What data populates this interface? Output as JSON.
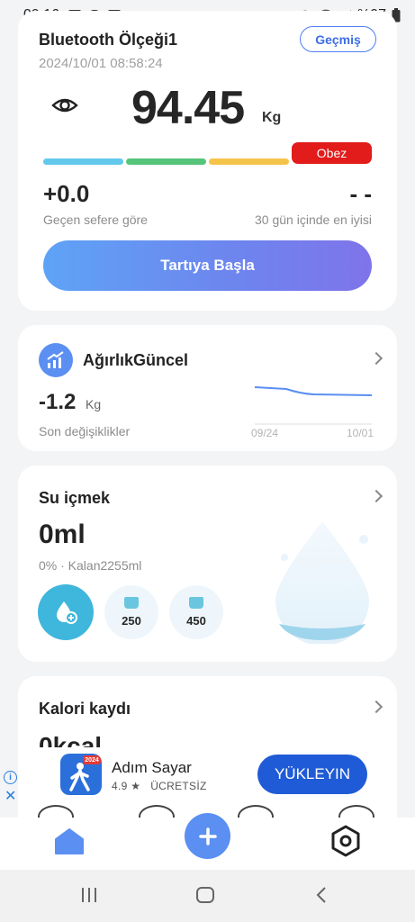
{
  "status_bar": {
    "time": "09:16",
    "battery": "%97",
    "icons": [
      "box-icon",
      "cloud-icon",
      "image-icon",
      "dot-icon",
      "alarm-icon",
      "wifi-icon",
      "signal-icon",
      "battery-icon"
    ]
  },
  "scale_card": {
    "device_name": "Bluetooth Ölçeği1",
    "history_label": "Geçmiş",
    "timestamp": "2024/10/01 08:58:24",
    "weight": "94.45",
    "unit": "Kg",
    "category_badge": "Obez",
    "category_colors": [
      "#62c8ec",
      "#56c47a",
      "#f4c34a",
      "#e21b1b"
    ],
    "diff_value": "+0.0",
    "diff_label": "Geçen sefere göre",
    "best_value": "- -",
    "best_label": "30 gün içinde en iyisi",
    "start_label": "Tartıya Başla"
  },
  "weight_card": {
    "title": "AğırlıkGüncel",
    "change_value": "-1.2",
    "change_unit": "Kg",
    "change_label": "Son değişiklikler",
    "chart_start": "09/24",
    "chart_end": "10/01"
  },
  "water_card": {
    "title": "Su içmek",
    "amount": "0ml",
    "sub": "0% · Kalan2255ml",
    "progress_percent": 0,
    "cups": [
      "250",
      "450"
    ]
  },
  "calorie_card": {
    "title": "Kalori kaydı",
    "value": "0kcal"
  },
  "ad": {
    "app_name": "Adım Sayar",
    "rating": "4.9 ★",
    "price": "ÜCRETSİZ",
    "badge": "2024",
    "install_label": "YÜKLEYIN"
  },
  "nav": {
    "items": [
      "home-icon",
      "add-icon",
      "settings-icon"
    ]
  },
  "colors": {
    "accent": "#5b8ff1",
    "water": "#3fb6dc",
    "danger": "#e21b1b"
  }
}
